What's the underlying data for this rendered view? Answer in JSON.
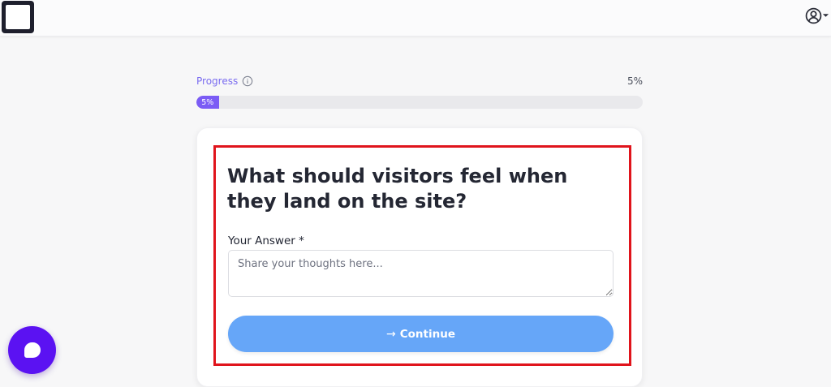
{
  "header": {
    "logo_icon": "square-logo-icon",
    "user_menu_icon": "user-circle-icon",
    "user_menu_caret": "caret-down-icon"
  },
  "progress": {
    "label": "Progress",
    "info_icon": "info-circle-icon",
    "percent_text": "5%",
    "bar_label": "5%",
    "value": 0.05,
    "fill_color": "#7b5cf5"
  },
  "question": {
    "title": "What should visitors feel when they land on the site?",
    "answer_label": "Your Answer *",
    "answer_value": "",
    "answer_placeholder": "Share your thoughts here..."
  },
  "actions": {
    "continue_icon": "→",
    "continue_label": "Continue",
    "button_color": "#66a6f8"
  },
  "chat": {
    "launcher_icon": "chat-bubble-icon",
    "launcher_color": "#5b12f2"
  },
  "highlight_color": "#e0141c"
}
